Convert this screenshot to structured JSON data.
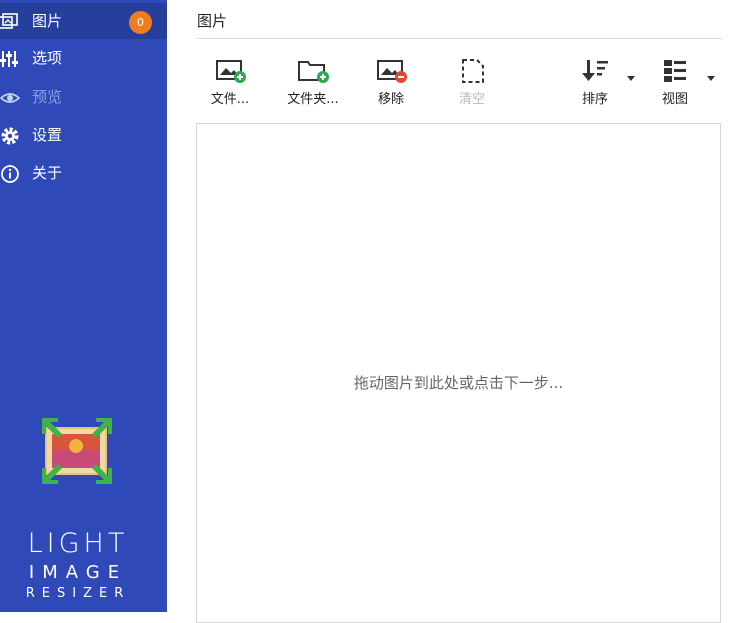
{
  "sidebar": {
    "items": [
      {
        "label": "图片",
        "icon": "images-icon",
        "badge": "0",
        "active": true
      },
      {
        "label": "选项",
        "icon": "sliders-icon"
      },
      {
        "label": "预览",
        "icon": "eye-icon",
        "disabled": true
      },
      {
        "label": "设置",
        "icon": "gear-icon"
      },
      {
        "label": "关于",
        "icon": "info-icon"
      }
    ],
    "logo": {
      "line1": "LIGHT",
      "line2": "IMAGE",
      "line3": "RESIZER"
    }
  },
  "main": {
    "title": "图片",
    "toolbar": {
      "add_files": "文件...",
      "add_folder": "文件夹...",
      "remove": "移除",
      "clear": "清空",
      "sort": "排序",
      "view": "视图"
    },
    "drop_hint": "拖动图片到此处或点击下一步..."
  },
  "colors": {
    "sidebar_bg": "#2f4ab8",
    "badge": "#f07c1e",
    "add_green": "#2fa84f",
    "remove_red": "#e04a2f"
  }
}
